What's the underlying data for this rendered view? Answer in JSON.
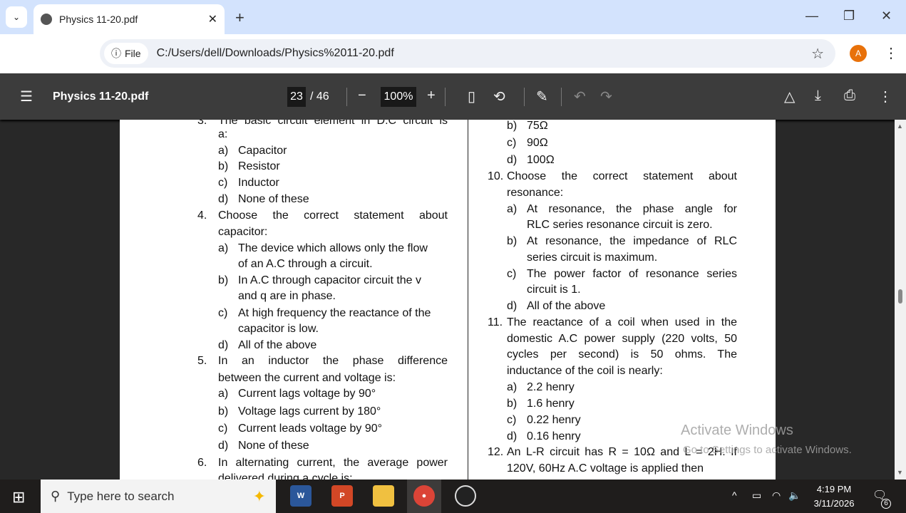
{
  "browser": {
    "tab_title": "Physics 11-20.pdf",
    "new_tab": "+",
    "site_chip": "File",
    "url": "C:/Users/dell/Downloads/Physics%2011-20.pdf",
    "avatar_letter": "A"
  },
  "viewer": {
    "title": "Physics 11-20.pdf",
    "page_current": "23",
    "page_total": "/ 46",
    "zoom": "100%"
  },
  "left_lines": [
    {
      "num": "3.",
      "text": "The basic circuit element in D.C circuit is"
    },
    {
      "text": "a:"
    },
    {
      "label": "a)",
      "text": "Capacitor"
    },
    {
      "label": "b)",
      "text": "Resistor"
    },
    {
      "label": "c)",
      "text": "Inductor"
    },
    {
      "label": "d)",
      "text": "None of these"
    },
    {
      "num": "4.",
      "text": "Choose the correct statement about"
    },
    {
      "text": "capacitor:"
    },
    {
      "label": "a)",
      "text": "The device which allows only the flow"
    },
    {
      "text": "of an A.C through a circuit."
    },
    {
      "label": "b)",
      "text": "In A.C through capacitor circuit the v"
    },
    {
      "text": "and q are in phase."
    },
    {
      "label": "c)",
      "text": "At high frequency the reactance of the"
    },
    {
      "text": "capacitor is low."
    },
    {
      "label": "d)",
      "text": "All of the above"
    },
    {
      "num": "5.",
      "text": "In an inductor the phase difference"
    },
    {
      "text": "between the current and voltage is:"
    },
    {
      "label": "a)",
      "text": "Current lags voltage by 90°"
    },
    {
      "label": "b)",
      "text": "Voltage lags current by 180°"
    },
    {
      "label": "c)",
      "text": "Current leads voltage by 90°"
    },
    {
      "label": "d)",
      "text": "None of these"
    },
    {
      "num": "6.",
      "text": "In alternating current, the average power"
    },
    {
      "text": "delivered during a cycle is:"
    }
  ],
  "right_lines": [
    {
      "label": "b)",
      "text": "75Ω"
    },
    {
      "label": "c)",
      "text": "90Ω"
    },
    {
      "label": "d)",
      "text": "100Ω"
    },
    {
      "num": "10.",
      "text": "Choose the correct statement about"
    },
    {
      "text": "resonance:"
    },
    {
      "label": "a)",
      "text": "At resonance, the phase angle for"
    },
    {
      "text": "RLC series resonance circuit is zero."
    },
    {
      "label": "b)",
      "text": "At resonance, the impedance of RLC"
    },
    {
      "text": "series circuit is maximum."
    },
    {
      "label": "c)",
      "text": "The power factor of resonance series"
    },
    {
      "text": "circuit is 1."
    },
    {
      "label": "d)",
      "text": "All of the above"
    },
    {
      "num": "11.",
      "text": "The reactance of a coil when used in the"
    },
    {
      "text": "domestic A.C power supply (220 volts, 50"
    },
    {
      "text": "cycles per second) is 50 ohms. The"
    },
    {
      "text": "inductance of the coil is nearly:"
    },
    {
      "label": "a)",
      "text": "2.2 henry"
    },
    {
      "label": "b)",
      "text": "1.6 henry"
    },
    {
      "label": "c)",
      "text": "0.22 henry"
    },
    {
      "label": "d)",
      "text": "0.16 henry"
    },
    {
      "num": "12.",
      "text": "An L-R circuit has R = 10Ω and L = 2H. If"
    },
    {
      "text": "120V, 60Hz A.C voltage is applied then"
    }
  ],
  "watermark": {
    "line1": "Activate Windows",
    "line2": "Go to Settings to activate Windows."
  },
  "taskbar": {
    "search_placeholder": "Type here to search",
    "time": "4:19 PM",
    "date": "3/11/2026",
    "notifications": "6"
  }
}
